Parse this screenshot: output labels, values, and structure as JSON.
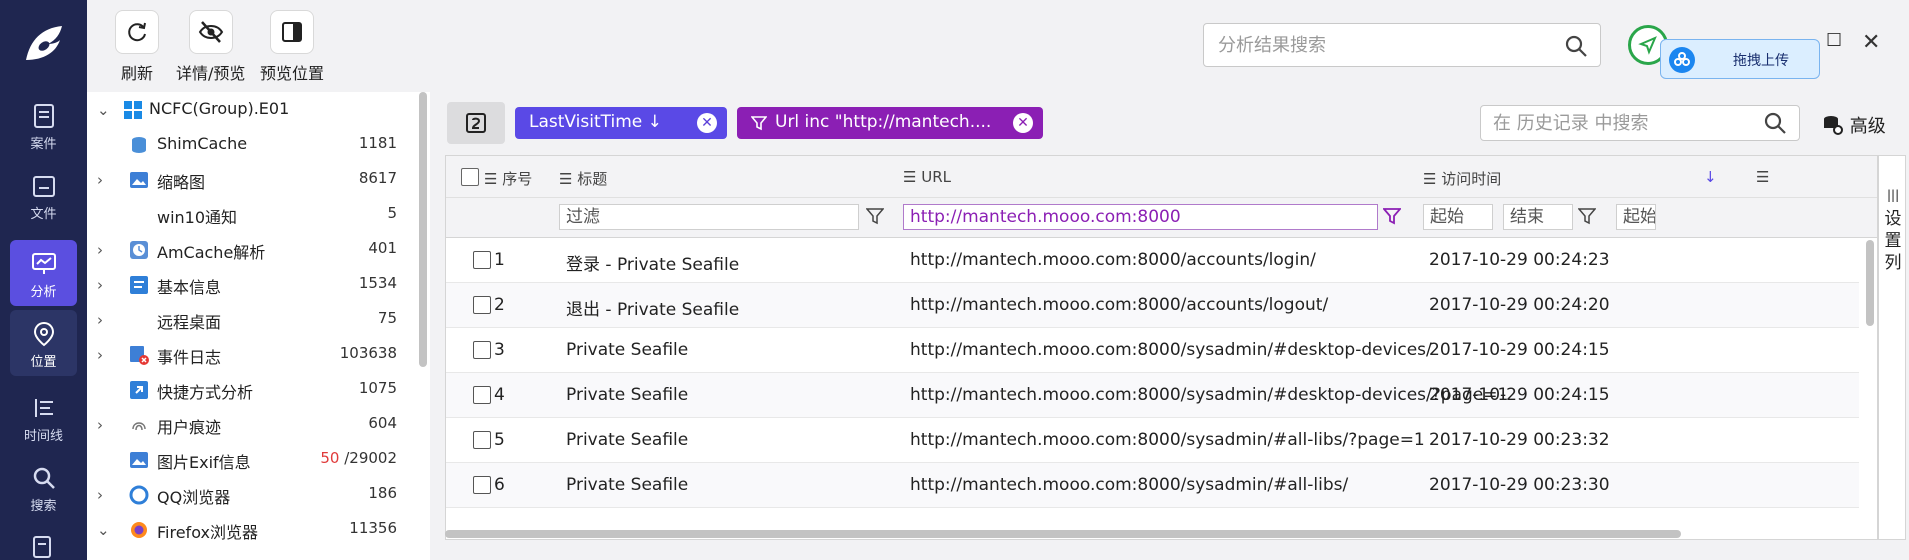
{
  "rail": {
    "items": [
      {
        "label": "案件",
        "icon": "case-icon"
      },
      {
        "label": "文件",
        "icon": "folder-icon"
      },
      {
        "label": "分析",
        "icon": "analysis-icon"
      },
      {
        "label": "位置",
        "icon": "location-pin-icon"
      },
      {
        "label": "时间线",
        "icon": "timeline-icon"
      },
      {
        "label": "搜索",
        "icon": "search-icon"
      }
    ]
  },
  "toolbar": {
    "refresh_label": "刷新",
    "details_label": "详情/预览",
    "preview_pos_label": "预览位置"
  },
  "top_search": {
    "placeholder": "分析结果搜索"
  },
  "upload": {
    "label": "拖拽上传"
  },
  "tree": {
    "items": [
      {
        "label": "NCFC(Group).E01",
        "count": ""
      },
      {
        "label": "ShimCache",
        "count": "1181"
      },
      {
        "label": "缩略图",
        "count": "8617"
      },
      {
        "label": "win10通知",
        "count": "5"
      },
      {
        "label": "AmCache解析",
        "count": "401"
      },
      {
        "label": "基本信息",
        "count": "1534"
      },
      {
        "label": "远程桌面",
        "count": "75"
      },
      {
        "label": "事件日志",
        "count": "103638"
      },
      {
        "label": "快捷方式分析",
        "count": "1075"
      },
      {
        "label": "用户痕迹",
        "count": "604"
      },
      {
        "label": "图片Exif信息",
        "count_red": "50",
        "count": "/29002"
      },
      {
        "label": "QQ浏览器",
        "count": "186"
      },
      {
        "label": "Firefox浏览器",
        "count": "11356"
      }
    ]
  },
  "filters": {
    "sort_chip": "LastVisitTime ↓",
    "url_chip": "Url inc \"http://mantech...."
  },
  "history_search": {
    "placeholder": "在 历史记录 中搜索"
  },
  "advanced_label": "高级",
  "grid": {
    "columns": [
      "序号",
      "标题",
      "URL",
      "访问时间"
    ],
    "filter_placeholder": "过滤",
    "url_filter_value": "http://mantech.mooo.com:8000",
    "start_placeholder": "起始",
    "end_placeholder": "结束",
    "rows": [
      {
        "no": "1",
        "title": "登录 - Private Seafile",
        "url": "http://mantech.mooo.com:8000/accounts/login/",
        "time": "2017-10-29 00:24:23"
      },
      {
        "no": "2",
        "title": "退出 - Private Seafile",
        "url": "http://mantech.mooo.com:8000/accounts/logout/",
        "time": "2017-10-29 00:24:20"
      },
      {
        "no": "3",
        "title": "Private Seafile",
        "url": "http://mantech.mooo.com:8000/sysadmin/#desktop-devices/",
        "time": "2017-10-29 00:24:15"
      },
      {
        "no": "4",
        "title": "Private Seafile",
        "url": "http://mantech.mooo.com:8000/sysadmin/#desktop-devices/?page=1",
        "time": "2017-10-29 00:24:15"
      },
      {
        "no": "5",
        "title": "Private Seafile",
        "url": "http://mantech.mooo.com:8000/sysadmin/#all-libs/?page=1",
        "time": "2017-10-29 00:23:32"
      },
      {
        "no": "6",
        "title": "Private Seafile",
        "url": "http://mantech.mooo.com:8000/sysadmin/#all-libs/",
        "time": "2017-10-29 00:23:30"
      }
    ]
  },
  "set_columns_label": "设置列",
  "colors": {
    "rail_bg": "#1f2650",
    "accent": "#5a49e6",
    "url_chip": "#8b1fb4"
  }
}
